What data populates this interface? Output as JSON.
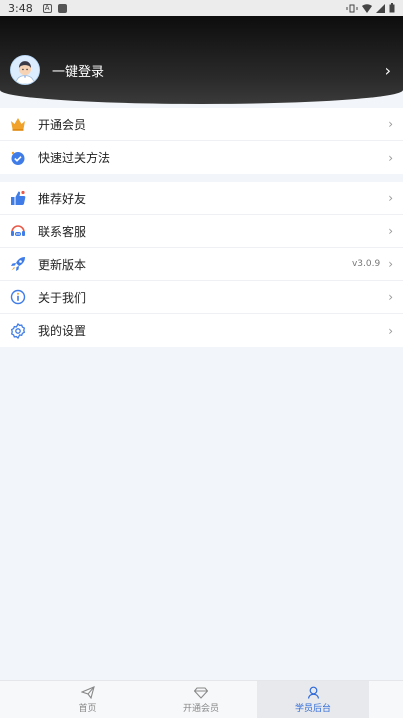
{
  "status_bar": {
    "time": "3:48"
  },
  "header": {
    "login_label": "一键登录"
  },
  "menu_group_1": [
    {
      "label": "开通会员",
      "icon": "crown-icon"
    },
    {
      "label": "快速过关方法",
      "icon": "check-badge-icon"
    }
  ],
  "menu_group_2": [
    {
      "label": "推荐好友",
      "icon": "thumbs-up-icon"
    },
    {
      "label": "联系客服",
      "icon": "headset-icon"
    },
    {
      "label": "更新版本",
      "icon": "rocket-icon",
      "extra": "v3.0.9"
    },
    {
      "label": "关于我们",
      "icon": "info-icon"
    },
    {
      "label": "我的设置",
      "icon": "gear-icon"
    }
  ],
  "bottom_nav": [
    {
      "label": "首页",
      "icon": "paper-plane-icon"
    },
    {
      "label": "开通会员",
      "icon": "diamond-icon"
    },
    {
      "label": "学员后台",
      "icon": "user-icon"
    }
  ],
  "colors": {
    "accent": "#2f6ad8",
    "header_dark": "#111111",
    "background": "#f2f5f9"
  }
}
